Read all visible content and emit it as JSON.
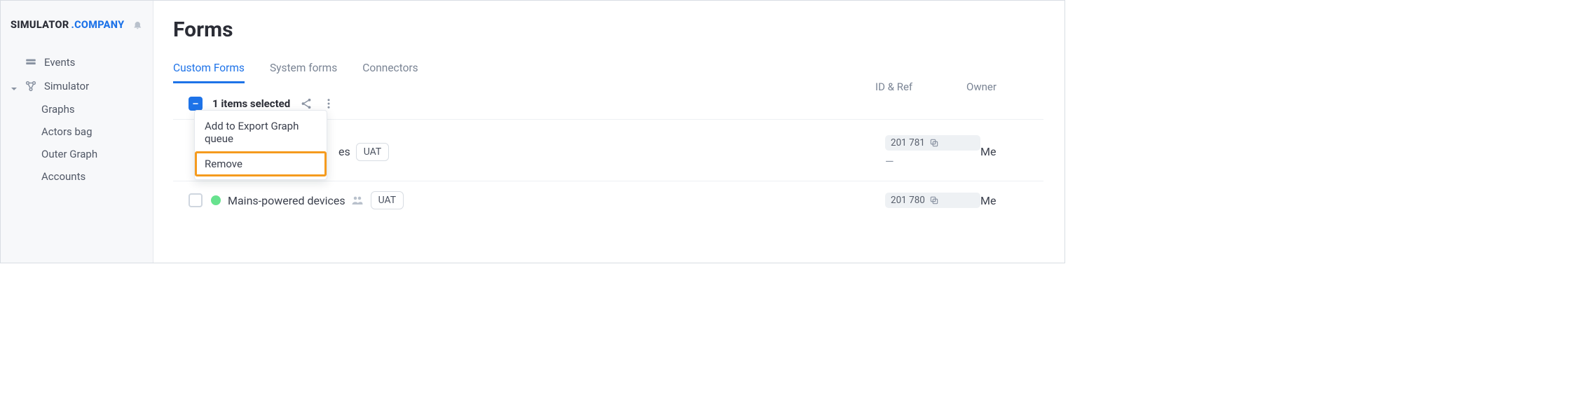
{
  "brand": {
    "part1": "SIMULATOR",
    "part2": ".COMPANY"
  },
  "sidebar": {
    "items": [
      {
        "label": "Events",
        "icon": "events-icon"
      },
      {
        "label": "Simulator",
        "icon": "simulator-icon",
        "expanded": true
      }
    ],
    "subitems": [
      {
        "label": "Graphs"
      },
      {
        "label": "Actors bag"
      },
      {
        "label": "Outer Graph"
      },
      {
        "label": "Accounts"
      }
    ]
  },
  "page": {
    "title": "Forms"
  },
  "tabs": [
    {
      "label": "Custom Forms",
      "active": true
    },
    {
      "label": "System forms",
      "active": false
    },
    {
      "label": "Connectors",
      "active": false
    }
  ],
  "selection": {
    "label": "1 items selected"
  },
  "columns": {
    "id": "ID & Ref",
    "owner": "Owner"
  },
  "dropdown": {
    "items": [
      {
        "label": "Add to Export Graph queue"
      },
      {
        "label": "Remove",
        "highlight": true
      }
    ]
  },
  "rows": [
    {
      "name_suffix": "es",
      "tag": "UAT",
      "id": "201 781",
      "ref": "—",
      "owner": "Me"
    },
    {
      "name": "Mains-powered devices",
      "tag": "UAT",
      "id": "201 780",
      "ref": "",
      "owner": "Me"
    }
  ]
}
